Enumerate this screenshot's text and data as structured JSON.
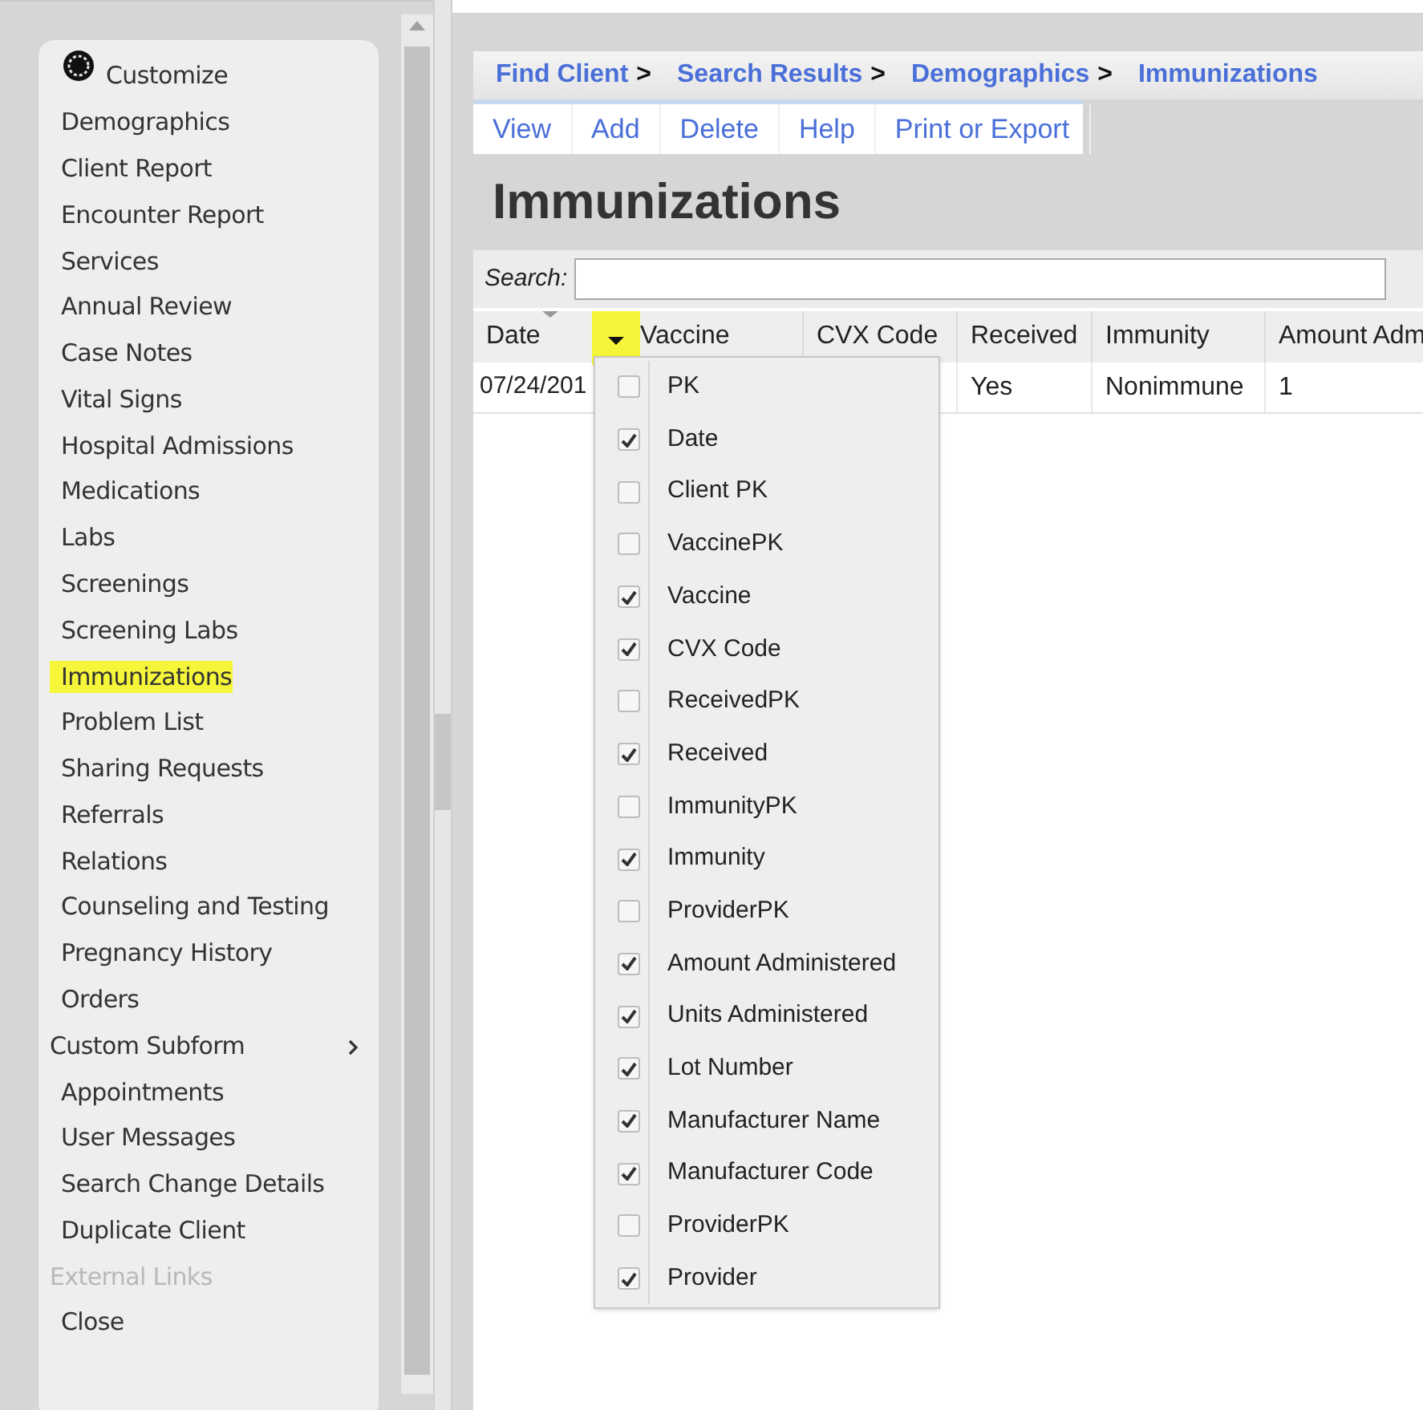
{
  "sidebar": {
    "items": [
      {
        "label": "Customize",
        "kind": "customize",
        "selected": false
      },
      {
        "label": "Demographics",
        "kind": "link",
        "selected": false
      },
      {
        "label": "Client Report",
        "kind": "link",
        "selected": false
      },
      {
        "label": "Encounter Report",
        "kind": "link",
        "selected": false
      },
      {
        "label": "Services",
        "kind": "link",
        "selected": false
      },
      {
        "label": "Annual Review",
        "kind": "link",
        "selected": false
      },
      {
        "label": "Case Notes",
        "kind": "link",
        "selected": false
      },
      {
        "label": "Vital Signs",
        "kind": "link",
        "selected": false
      },
      {
        "label": "Hospital Admissions",
        "kind": "link",
        "selected": false
      },
      {
        "label": "Medications",
        "kind": "link",
        "selected": false
      },
      {
        "label": "Labs",
        "kind": "link",
        "selected": false
      },
      {
        "label": "Screenings",
        "kind": "link",
        "selected": false
      },
      {
        "label": "Screening Labs",
        "kind": "link",
        "selected": false
      },
      {
        "label": "Immunizations",
        "kind": "link",
        "selected": true
      },
      {
        "label": "Problem List",
        "kind": "link",
        "selected": false
      },
      {
        "label": "Sharing Requests",
        "kind": "link",
        "selected": false
      },
      {
        "label": "Referrals",
        "kind": "link",
        "selected": false
      },
      {
        "label": "Relations",
        "kind": "link",
        "selected": false
      },
      {
        "label": "Counseling and Testing",
        "kind": "link",
        "selected": false
      },
      {
        "label": "Pregnancy History",
        "kind": "link",
        "selected": false
      },
      {
        "label": "Orders",
        "kind": "link",
        "selected": false
      },
      {
        "label": "Custom Subform",
        "kind": "submenu",
        "selected": false
      },
      {
        "label": "Appointments",
        "kind": "link",
        "selected": false
      },
      {
        "label": "User Messages",
        "kind": "link",
        "selected": false
      },
      {
        "label": "Search Change Details",
        "kind": "link",
        "selected": false
      },
      {
        "label": "Duplicate Client",
        "kind": "link",
        "selected": false
      },
      {
        "label": "External Links",
        "kind": "disabled",
        "selected": false
      },
      {
        "label": "Close",
        "kind": "link",
        "selected": false
      }
    ]
  },
  "breadcrumb": [
    {
      "label": "Find Client",
      "separator": ">"
    },
    {
      "label": "Search Results",
      "separator": ">"
    },
    {
      "label": "Demographics",
      "separator": ">"
    },
    {
      "label": "Immunizations"
    }
  ],
  "toolbar": [
    "View",
    "Add",
    "Delete",
    "Help",
    "Print or Export"
  ],
  "page_title": "Immunizations",
  "search": {
    "label": "Search:"
  },
  "table": {
    "columns": [
      "Date",
      "Vaccine",
      "CVX Code",
      "Received",
      "Immunity",
      "Amount Adm"
    ],
    "rows": [
      [
        "07/24/201",
        "",
        "",
        "Yes",
        "Nonimmune",
        "1"
      ]
    ]
  },
  "column_menu": {
    "items": [
      {
        "label": "PK",
        "checked": false
      },
      {
        "label": "Date",
        "checked": true
      },
      {
        "label": "Client PK",
        "checked": false
      },
      {
        "label": "VaccinePK",
        "checked": false
      },
      {
        "label": "Vaccine",
        "checked": true
      },
      {
        "label": "CVX Code",
        "checked": true
      },
      {
        "label": "ReceivedPK",
        "checked": false
      },
      {
        "label": "Received",
        "checked": true
      },
      {
        "label": "ImmunityPK",
        "checked": false
      },
      {
        "label": "Immunity",
        "checked": true
      },
      {
        "label": "ProviderPK",
        "checked": false
      },
      {
        "label": "Amount Administered",
        "checked": true
      },
      {
        "label": "Units Administered",
        "checked": true
      },
      {
        "label": "Lot Number",
        "checked": true
      },
      {
        "label": "Manufacturer Name",
        "checked": true
      },
      {
        "label": "Manufacturer Code",
        "checked": true
      },
      {
        "label": "ProviderPK",
        "checked": false
      },
      {
        "label": "Provider",
        "checked": true
      }
    ]
  }
}
